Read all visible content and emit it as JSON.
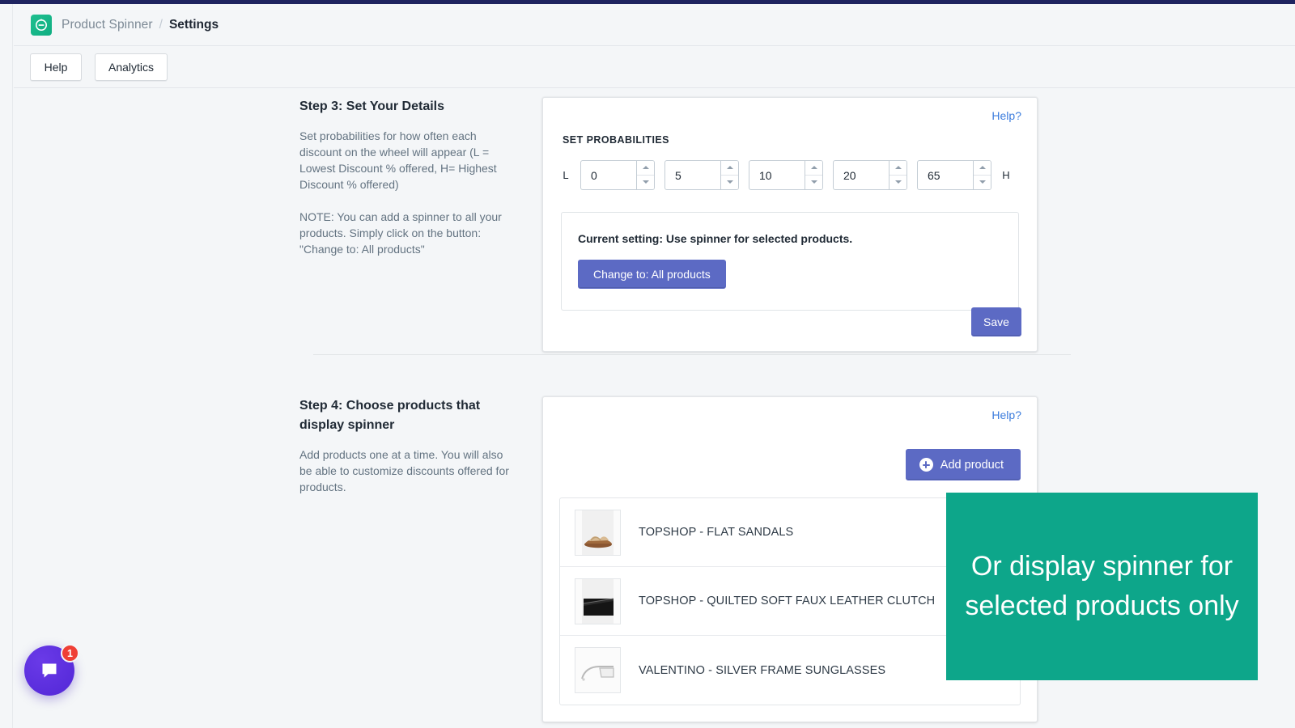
{
  "theme": {
    "accent_purple": "#5c6ac4",
    "accent_green": "#0da68a",
    "link_blue": "#3d7ddd",
    "top_bar_navy": "#1f2460",
    "page_bg": "#f4f6f8",
    "chat_purple": "#5227d6",
    "badge_red": "#ef3f36"
  },
  "header": {
    "logo_icon": "spinner-logo-icon",
    "app_name": "Product Spinner",
    "separator": "/",
    "current_page": "Settings"
  },
  "action_bar": {
    "buttons": [
      {
        "label": "Help",
        "name": "help-button"
      },
      {
        "label": "Analytics",
        "name": "analytics-button"
      }
    ]
  },
  "step3": {
    "title": "Step 3: Set Your Details",
    "desc1": "Set probabilities for how often each discount on the wheel will appear (L = Lowest Discount % offered, H= Highest Discount % offered)",
    "desc2": "NOTE: You can add a spinner to all your products. Simply click on the button: \"Change to: All products\"",
    "help_label": "Help?",
    "section_label": "SET PROBABILITIES",
    "low_cap": "L",
    "high_cap": "H",
    "probabilities": [
      "0",
      "5",
      "10",
      "20",
      "65"
    ],
    "current_setting_text": "Current setting: Use spinner for selected products.",
    "change_button_label": "Change to: All products",
    "save_button_label": "Save"
  },
  "step4": {
    "title": "Step 4: Choose products that display spinner",
    "desc1": "Add products one at a time. You will also be able to customize discounts offered for products.",
    "help_label": "Help?",
    "add_button_label": "Add product",
    "add_button_icon": "plus-circle-icon",
    "products": [
      {
        "name": "TOPSHOP - FLAT SANDALS",
        "thumb": "sandal-thumbnail"
      },
      {
        "name": "TOPSHOP - QUILTED SOFT FAUX LEATHER CLUTCH",
        "thumb": "clutch-thumbnail"
      },
      {
        "name": "VALENTINO - SILVER FRAME SUNGLASSES",
        "thumb": "sunglasses-thumbnail"
      }
    ]
  },
  "callout": {
    "text": "Or display spinner for selected products only"
  },
  "chat_widget": {
    "icon": "chat-bubble-icon",
    "unread_count": "1"
  }
}
